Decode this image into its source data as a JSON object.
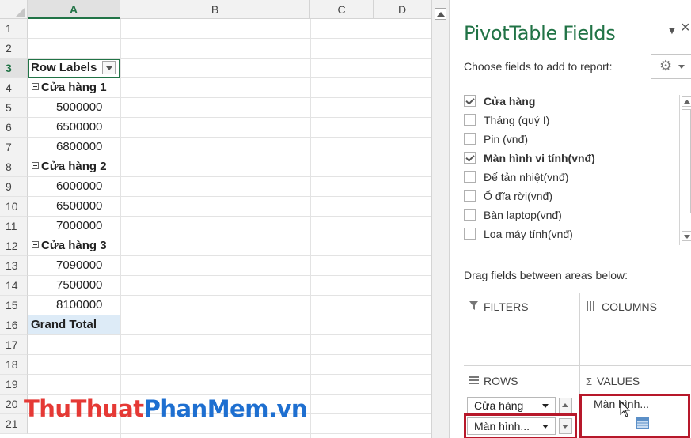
{
  "sheet": {
    "columns": [
      "A",
      "B",
      "C",
      "D"
    ],
    "row_numbers": [
      "1",
      "2",
      "3",
      "4",
      "5",
      "6",
      "7",
      "8",
      "9",
      "10",
      "11",
      "12",
      "13",
      "14",
      "15",
      "16",
      "17",
      "18",
      "19",
      "20",
      "21"
    ],
    "row_labels_header": "Row Labels",
    "rows": [
      {
        "type": "empty",
        "text": ""
      },
      {
        "type": "empty",
        "text": ""
      },
      {
        "type": "header",
        "text": "Row Labels"
      },
      {
        "type": "group",
        "text": "Cửa hàng 1"
      },
      {
        "type": "num",
        "text": "5000000"
      },
      {
        "type": "num",
        "text": "6500000"
      },
      {
        "type": "num",
        "text": "6800000"
      },
      {
        "type": "group",
        "text": "Cửa hàng 2"
      },
      {
        "type": "num",
        "text": "6000000"
      },
      {
        "type": "num",
        "text": "6500000"
      },
      {
        "type": "num",
        "text": "7000000"
      },
      {
        "type": "group",
        "text": "Cửa hàng 3"
      },
      {
        "type": "num",
        "text": "7090000"
      },
      {
        "type": "num",
        "text": "7500000"
      },
      {
        "type": "num",
        "text": "8100000"
      },
      {
        "type": "grand",
        "text": "Grand Total"
      },
      {
        "type": "empty",
        "text": ""
      },
      {
        "type": "empty",
        "text": ""
      },
      {
        "type": "empty",
        "text": ""
      },
      {
        "type": "empty",
        "text": ""
      },
      {
        "type": "empty",
        "text": ""
      }
    ],
    "active_cell": "A3"
  },
  "watermark": {
    "part1": "ThuThuat",
    "part2": "PhanMem.vn",
    "color1": "#e53935",
    "color2": "#1e6fd0"
  },
  "pivot": {
    "title": "PivotTable Fields",
    "choose_label": "Choose fields to add to report:",
    "fields": [
      {
        "label": "Cửa hàng",
        "checked": true
      },
      {
        "label": "Tháng  (quý I)",
        "checked": false
      },
      {
        "label": "Pin (vnđ)",
        "checked": false
      },
      {
        "label": "Màn hình vi tính(vnđ)",
        "checked": true
      },
      {
        "label": "Đế tản nhiệt(vnđ)",
        "checked": false
      },
      {
        "label": "Ổ đĩa rời(vnđ)",
        "checked": false
      },
      {
        "label": "Bàn laptop(vnđ)",
        "checked": false
      },
      {
        "label": "Loa máy tính(vnđ)",
        "checked": false
      }
    ],
    "drag_label": "Drag fields between areas below:",
    "areas": {
      "filters": "FILTERS",
      "columns": "COLUMNS",
      "rows": "ROWS",
      "values": "VALUES"
    },
    "rows_items": [
      "Cửa hàng",
      "Màn hình..."
    ],
    "values_drag_text": "Màn hình...",
    "accent_color": "#217346",
    "highlight_color": "#b7182a"
  }
}
